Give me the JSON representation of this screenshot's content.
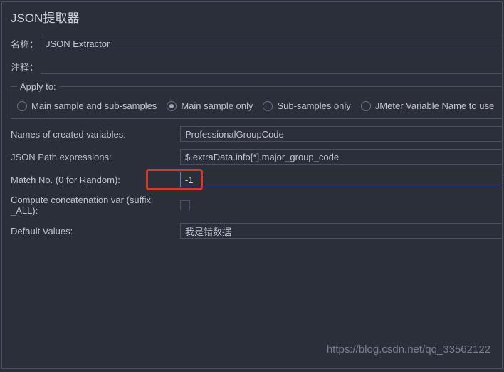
{
  "panel": {
    "title": "JSON提取器",
    "name_label": "名称：",
    "name_value": "JSON Extractor",
    "comment_label": "注释：",
    "comment_value": ""
  },
  "apply_to": {
    "legend": "Apply to:",
    "options": [
      {
        "label": "Main sample and sub-samples",
        "selected": false
      },
      {
        "label": "Main sample only",
        "selected": true
      },
      {
        "label": "Sub-samples only",
        "selected": false
      },
      {
        "label": "JMeter Variable Name to use",
        "selected": false
      }
    ]
  },
  "fields": {
    "names_label": "Names of created variables:",
    "names_value": "ProfessionalGroupCode",
    "jsonpath_label": "JSON Path expressions:",
    "jsonpath_value": "$.extraData.info[*].major_group_code",
    "matchno_label": "Match No. (0 for Random):",
    "matchno_value": "-1",
    "concat_label": "Compute concatenation var (suffix _ALL):",
    "concat_checked": false,
    "default_label": "Default Values:",
    "default_value": "我是错数据"
  },
  "watermark": "https://blog.csdn.net/qq_33562122"
}
